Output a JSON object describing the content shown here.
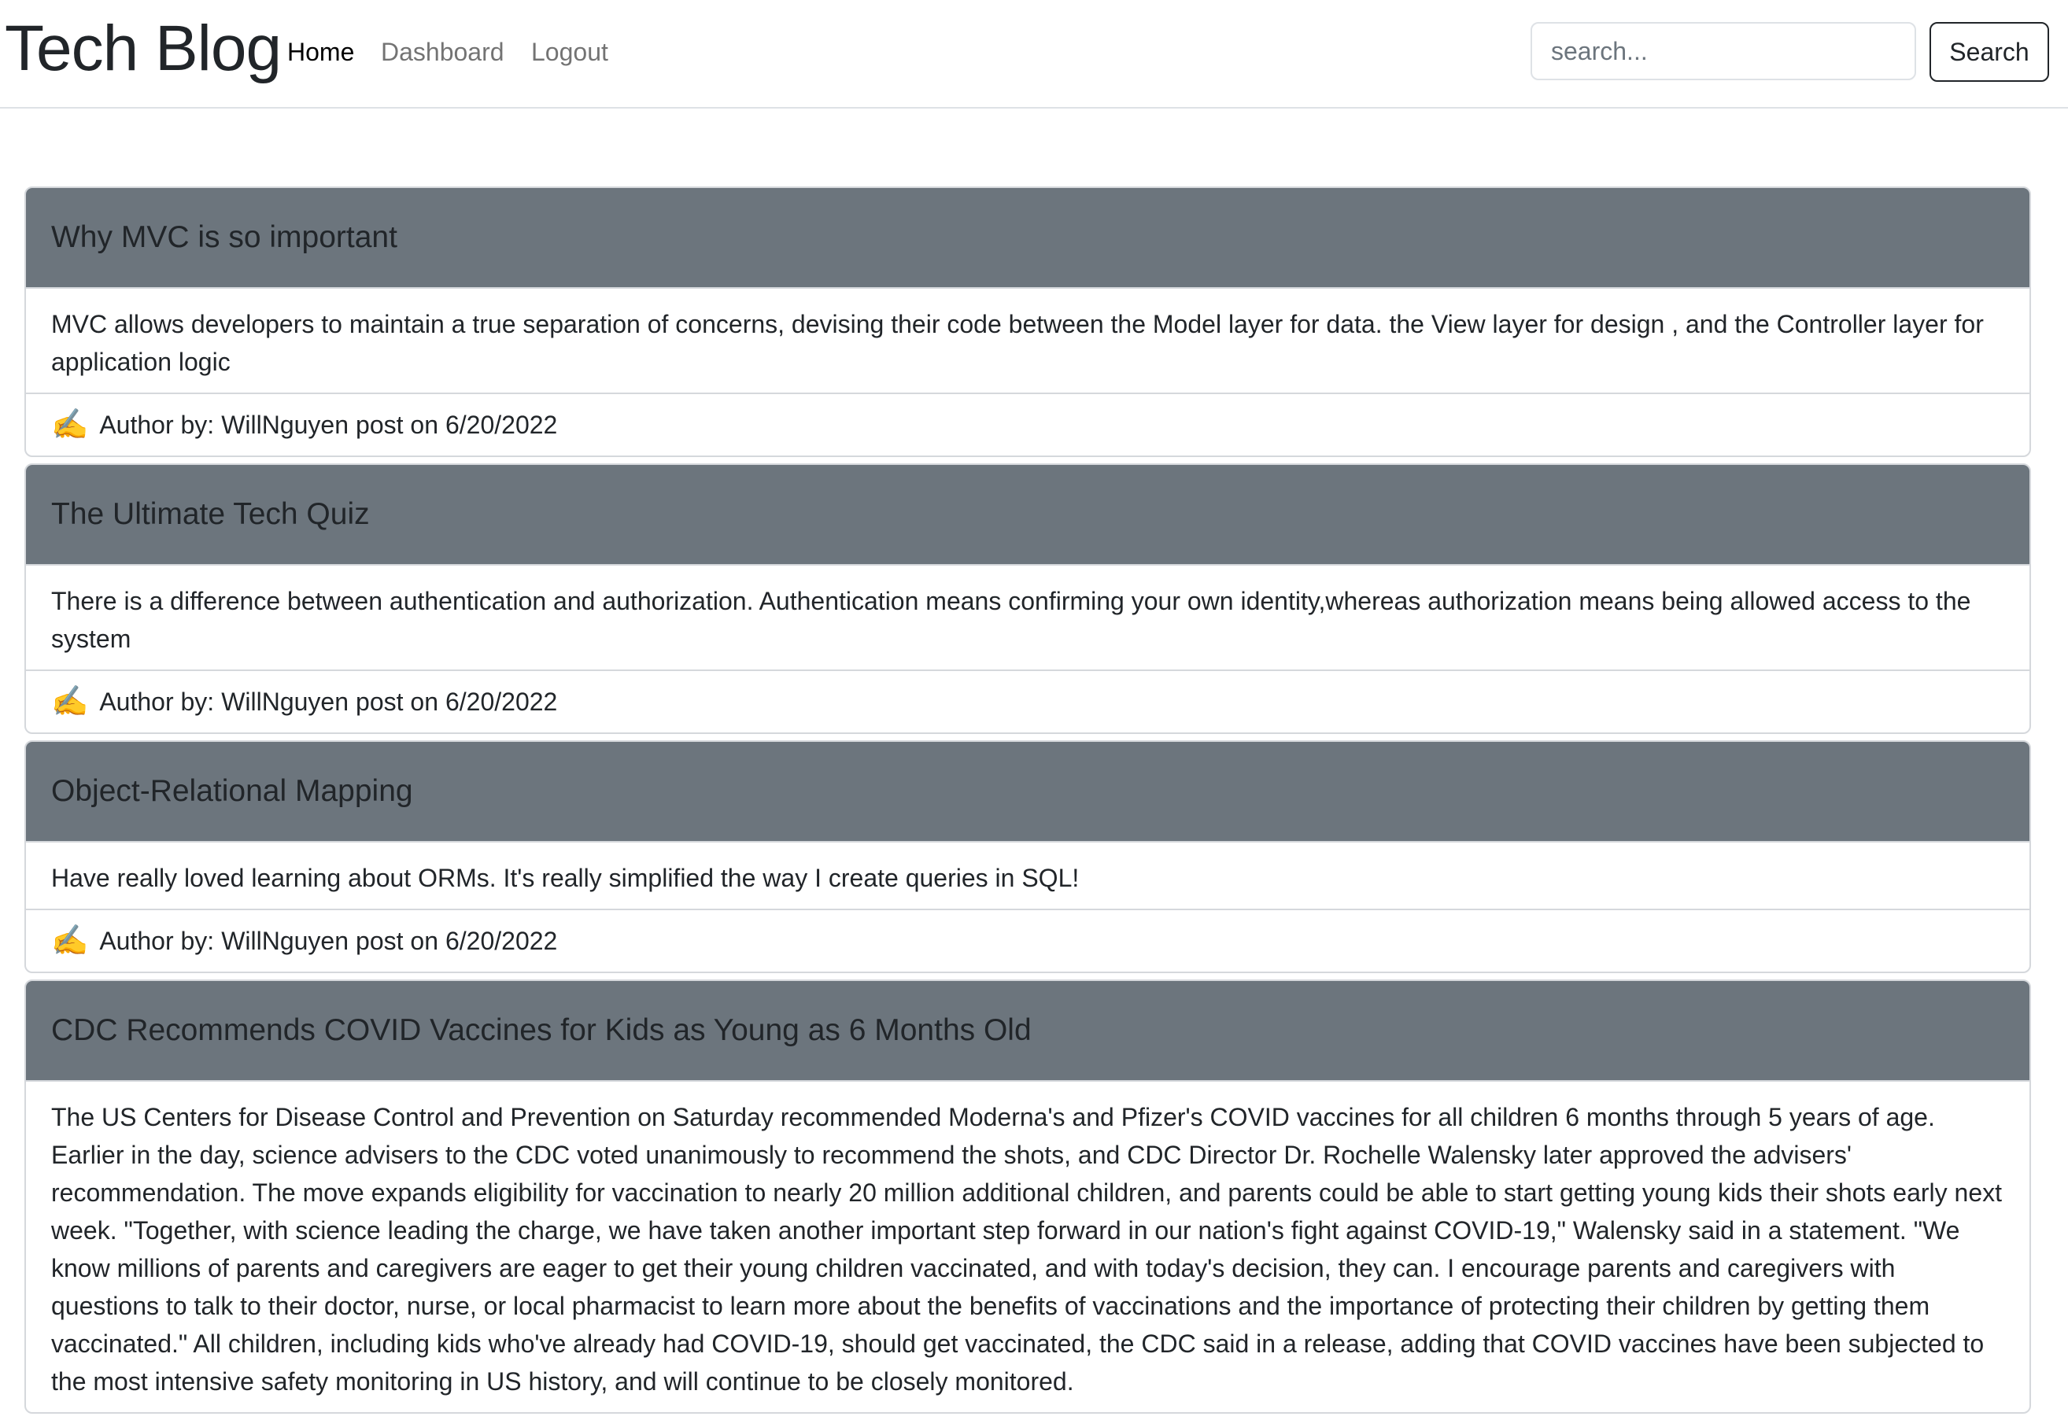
{
  "header": {
    "brand": "Tech Blog",
    "nav": {
      "home": "Home",
      "dashboard": "Dashboard",
      "logout": "Logout"
    },
    "search": {
      "placeholder": "search...",
      "button_label": "Search"
    }
  },
  "posts": [
    {
      "title": "Why MVC is so important",
      "body": "MVC allows developers to maintain a true separation of concerns, devising their code between the Model layer for data. the View layer for design , and the Controller layer for application logic",
      "author_icon": "✍️",
      "author_label": "Author by:",
      "author": "WillNguyen",
      "posted_label": "post on",
      "date": "6/20/2022"
    },
    {
      "title": "The Ultimate Tech Quiz",
      "body": "There is a difference between authentication and authorization. Authentication means confirming your own identity,whereas authorization means being allowed access to the system",
      "author_icon": "✍️",
      "author_label": "Author by:",
      "author": "WillNguyen",
      "posted_label": "post on",
      "date": "6/20/2022"
    },
    {
      "title": "Object-Relational Mapping",
      "body": "Have really loved learning about ORMs. It's really simplified the way I create queries in SQL!",
      "author_icon": "✍️",
      "author_label": "Author by:",
      "author": "WillNguyen",
      "posted_label": "post on",
      "date": "6/20/2022"
    },
    {
      "title": "CDC Recommends COVID Vaccines for Kids as Young as 6 Months Old",
      "body": "The US Centers for Disease Control and Prevention on Saturday recommended Moderna's and Pfizer's COVID vaccines for all children 6 months through 5 years of age. Earlier in the day, science advisers to the CDC voted unanimously to recommend the shots, and CDC Director Dr. Rochelle Walensky later approved the advisers' recommendation. The move expands eligibility for vaccination to nearly 20 million additional children, and parents could be able to start getting young kids their shots early next week. \"Together, with science leading the charge, we have taken another important step forward in our nation's fight against COVID-19,\" Walensky said in a statement. \"We know millions of parents and caregivers are eager to get their young children vaccinated, and with today's decision, they can. I encourage parents and caregivers with questions to talk to their doctor, nurse, or local pharmacist to learn more about the benefits of vaccinations and the importance of protecting their children by getting them vaccinated.\"  All children, including kids who've already had COVID-19, should get vaccinated, the CDC said in a release, adding that COVID vaccines have been subjected to the most intensive safety monitoring in US history, and will continue to be closely monitored."
    }
  ],
  "colors": {
    "card_header_bg": "#6c757d",
    "border": "#dee2e6",
    "text": "#212529"
  }
}
